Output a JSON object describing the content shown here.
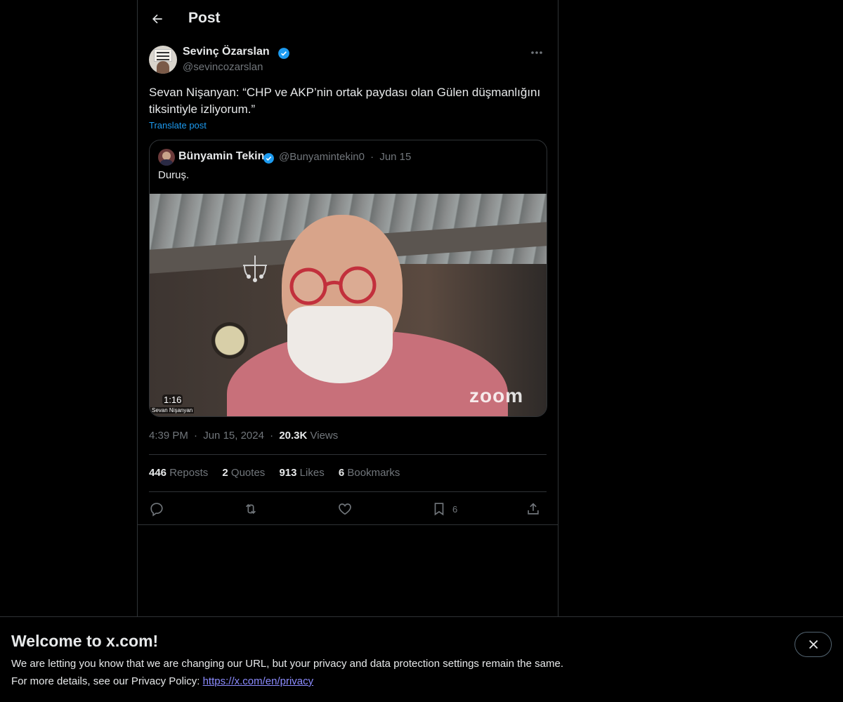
{
  "header": {
    "title": "Post"
  },
  "post": {
    "author": {
      "name": "Sevinç Özarslan",
      "handle": "@sevincozarslan"
    },
    "text": "Sevan Nişanyan: “CHP ve AKP’nin ortak paydası olan Gülen düşmanlığını tiksintiyle izliyorum.”",
    "translate_label": "Translate post",
    "quote": {
      "name": "Bünyamin Tekin",
      "handle": "@Bunyamintekin0",
      "separator": "·",
      "date": "Jun 15",
      "text": "Duruş.",
      "video": {
        "duration": "1:16",
        "caption": "Sevan Nişanyan",
        "watermark": "zoom"
      }
    },
    "time": "4:39 PM",
    "date": "Jun 15, 2024",
    "separator": "·",
    "views_count": "20.3K",
    "views_label": "Views",
    "stats": {
      "reposts_count": "446",
      "reposts_label": "Reposts",
      "quotes_count": "2",
      "quotes_label": "Quotes",
      "likes_count": "913",
      "likes_label": "Likes",
      "bookmarks_count": "6",
      "bookmarks_label": "Bookmarks"
    },
    "actions": {
      "reply_icon": "reply-icon",
      "repost_icon": "repost-icon",
      "like_icon": "heart-icon",
      "bookmark_icon": "bookmark-icon",
      "bookmark_count": "6",
      "share_icon": "share-icon"
    }
  },
  "banner": {
    "title": "Welcome to x.com!",
    "line1": "We are letting you know that we are changing our URL, but your privacy and data protection settings remain the same.",
    "line2_prefix": "For more details, see our Privacy Policy: ",
    "link": "https://x.com/en/privacy"
  },
  "colors": {
    "background": "#000000",
    "text": "#e7e9ea",
    "muted": "#71767b",
    "accent": "#1d9bf0",
    "border": "#2f3336",
    "link": "#8c8cff"
  }
}
